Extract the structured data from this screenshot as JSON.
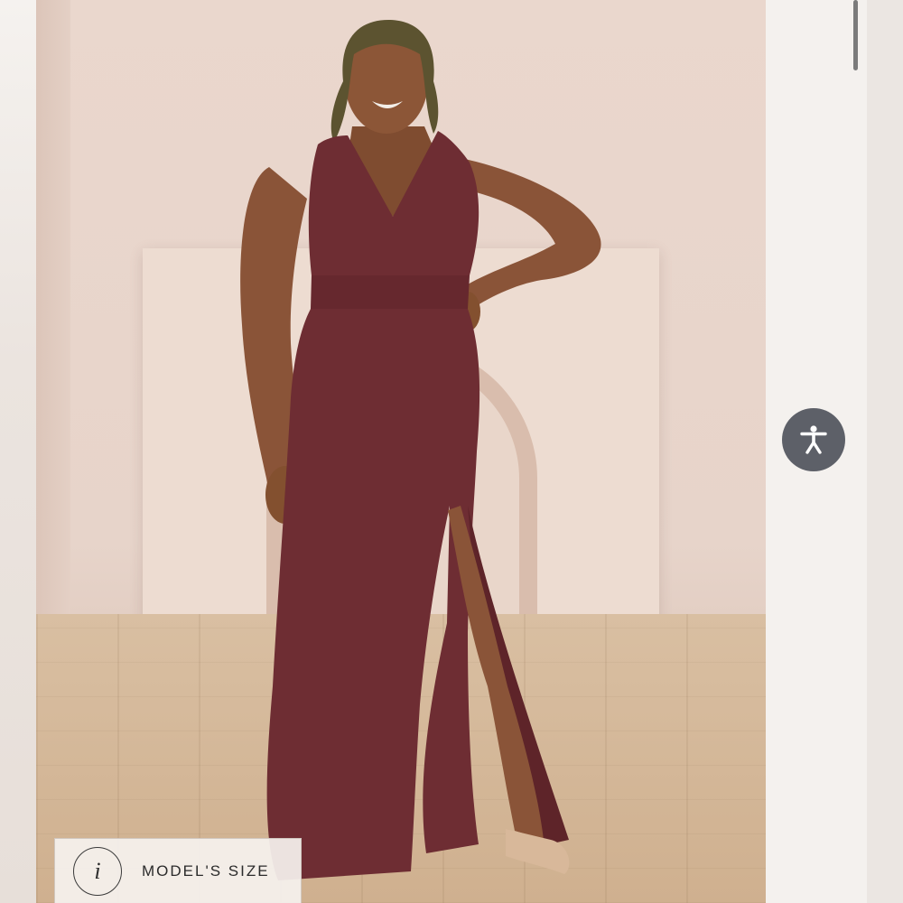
{
  "product_gallery": {
    "model_size_badge": {
      "icon_glyph": "i",
      "label": "MODEL'S SIZE"
    },
    "accessibility_button": {
      "icon": "accessibility-person-icon"
    }
  },
  "colors": {
    "dress": "#6e2d33",
    "background_wall": "#ead7cd",
    "floor": "#d4b596",
    "accessibility_button": "#5d6068"
  }
}
